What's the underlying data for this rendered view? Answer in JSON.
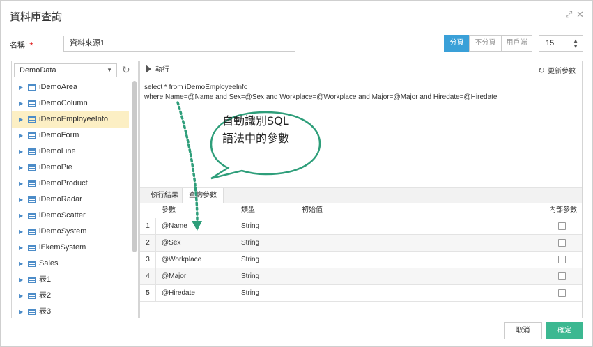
{
  "dialog": {
    "title": "資料庫查詢",
    "expand_glyph": "⤢",
    "close_glyph": "✕"
  },
  "name_field": {
    "label": "名稱:",
    "required_mark": "*",
    "value": "資料來源1"
  },
  "paging": {
    "options": [
      "分頁",
      "不分頁",
      "用戶端"
    ],
    "selected": "分頁",
    "page_size": "15"
  },
  "database": {
    "selected": "DemoData",
    "tables": [
      "iDemoArea",
      "iDemoColumn",
      "iDemoEmployeeInfo",
      "iDemoForm",
      "iDemoLine",
      "iDemoPie",
      "iDemoProduct",
      "iDemoRadar",
      "iDemoScatter",
      "iDemoSystem",
      "iEkemSystem",
      "Sales",
      "表1",
      "表2",
      "表3"
    ],
    "selected_table": "iDemoEmployeeInfo"
  },
  "toolbar": {
    "run_label": "執行",
    "update_params_label": "更新參數"
  },
  "sql": {
    "line1": "select * from iDemoEmployeeInfo",
    "line2": "where Name=@Name and Sex=@Sex and Workplace=@Workplace and Major=@Major and Hiredate=@Hiredate"
  },
  "tabs": [
    {
      "label": "執行結果",
      "active": false
    },
    {
      "label": "查詢參數",
      "active": true
    }
  ],
  "grid": {
    "headers": {
      "param": "參數",
      "type": "類型",
      "initial": "初始值",
      "internal": "內部參數"
    },
    "rows": [
      {
        "num": "1",
        "param": "@Name",
        "type": "String",
        "initial": "",
        "internal": false
      },
      {
        "num": "2",
        "param": "@Sex",
        "type": "String",
        "initial": "",
        "internal": false
      },
      {
        "num": "3",
        "param": "@Workplace",
        "type": "String",
        "initial": "",
        "internal": false
      },
      {
        "num": "4",
        "param": "@Major",
        "type": "String",
        "initial": "",
        "internal": false
      },
      {
        "num": "5",
        "param": "@Hiredate",
        "type": "String",
        "initial": "",
        "internal": false
      }
    ]
  },
  "callout": {
    "line1": "自動識別SQL",
    "line2": "語法中的參數",
    "border_color": "#2e9e7a"
  },
  "footer": {
    "cancel_label": "取消",
    "ok_label": "確定"
  },
  "colors": {
    "accent": "#3aa0d8",
    "primary_button": "#3cb891",
    "selected_row": "#fcefc4"
  }
}
